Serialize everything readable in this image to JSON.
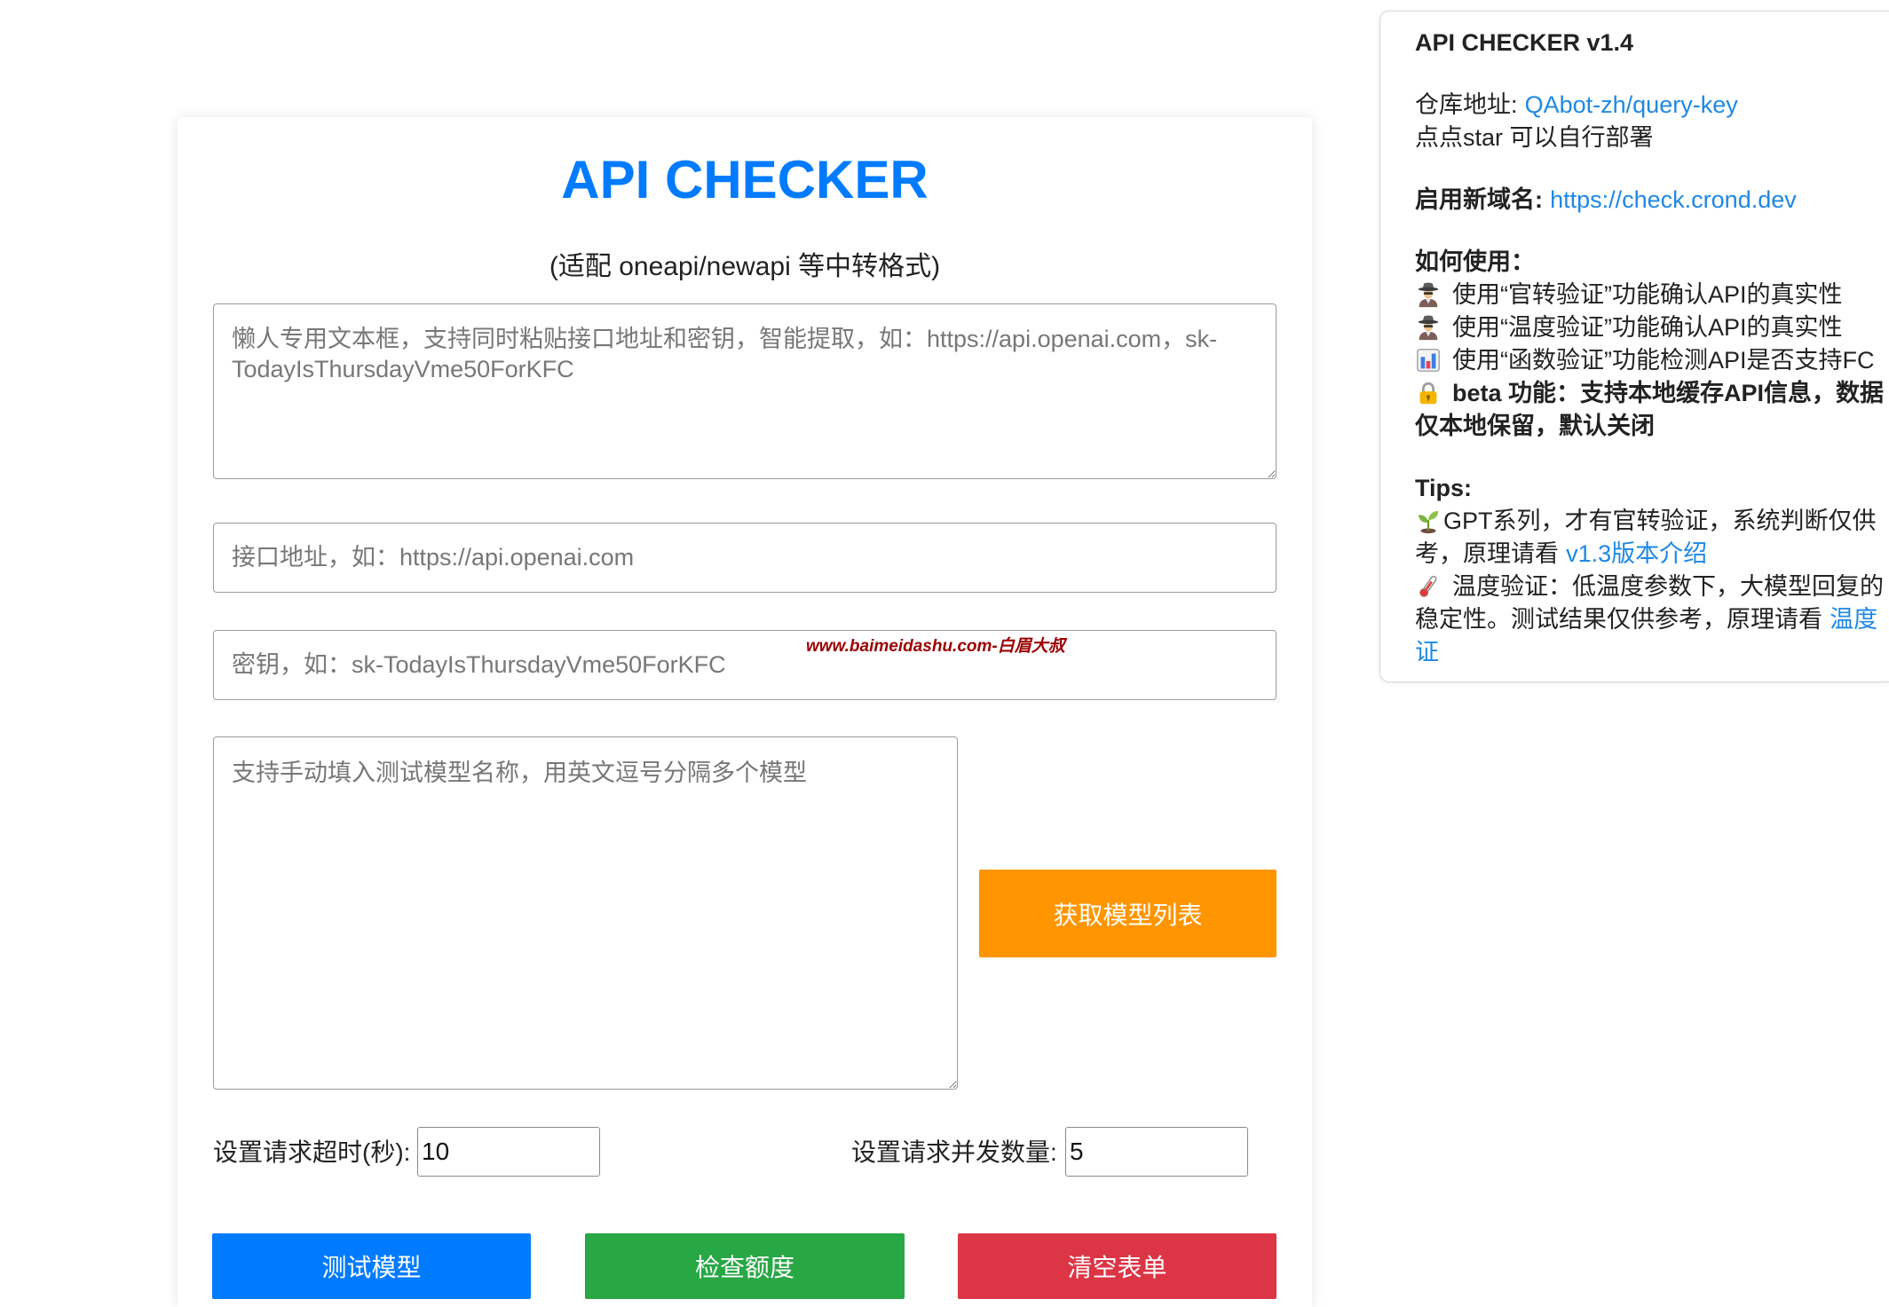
{
  "main": {
    "title": "API CHECKER",
    "subtitle": "(适配 oneapi/newapi 等中转格式)",
    "smart_paste_placeholder": "懒人专用文本框，支持同时粘贴接口地址和密钥，智能提取，如：https://api.openai.com，sk-TodayIsThursdayVme50ForKFC",
    "api_url_placeholder": "接口地址，如：https://api.openai.com",
    "api_key_placeholder": "密钥，如：sk-TodayIsThursdayVme50ForKFC",
    "model_names_placeholder": "支持手动填入测试模型名称，用英文逗号分隔多个模型",
    "fetch_models_label": "获取模型列表",
    "timeout_label": "设置请求超时(秒):",
    "timeout_value": "10",
    "concurrency_label": "设置请求并发数量:",
    "concurrency_value": "5",
    "test_models_label": "测试模型",
    "check_quota_label": "检查额度",
    "clear_form_label": "清空表单"
  },
  "watermark": "www.baimeidashu.com-白眉大叔",
  "info_panel": {
    "title": "API CHECKER v1.4",
    "repo_label": "仓库地址:",
    "repo_link": "QAbot-zh/query-key",
    "star_note": "点点star 可以自行部署",
    "domain_label": "启用新域名:",
    "domain_link": "https://check.crond.dev",
    "usage_heading": "如何使用：",
    "usage_items": [
      {
        "icon": "detective-icon",
        "text": "使用“官转验证”功能确认API的真实性"
      },
      {
        "icon": "detective-icon",
        "text": "使用“温度验证”功能确认API的真实性"
      },
      {
        "icon": "bar-chart-icon",
        "text": "使用“函数验证”功能检测API是否支持FC"
      }
    ],
    "beta": {
      "icon": "lock-icon",
      "lines": [
        "beta 功能：支持本地缓存API信息，数据",
        "仅本地保留，默认关闭"
      ]
    },
    "tips_heading": "Tips:",
    "tips": {
      "gpt": {
        "icon": "seedling-icon",
        "line1": "GPT系列，才有官转验证，系统判断仅供",
        "line2_text": "考，原理请看",
        "line2_link": "v1.3版本介绍"
      },
      "temperature": {
        "icon": "thermometer-icon",
        "line1": "温度验证：低温度参数下，大模型回复的",
        "line2_text": "稳定性。测试结果仅供参考，原理请看",
        "line2_link": "温度",
        "line3_link": "证"
      }
    }
  },
  "colors": {
    "title": "#007bff",
    "fetch_button": "#ff9500",
    "test_button": "#007bff",
    "check_button": "#28a745",
    "clear_button": "#dc3545",
    "link": "#1e88e5",
    "watermark": "#9b0000"
  }
}
